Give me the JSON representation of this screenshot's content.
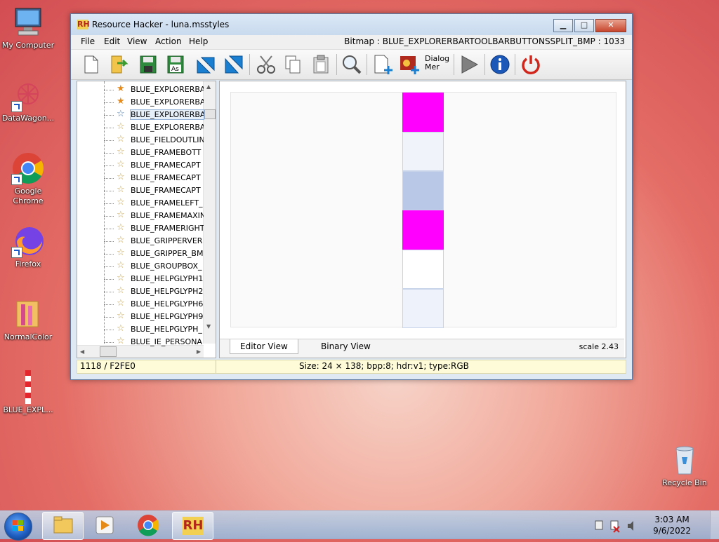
{
  "desktop": {
    "icons": [
      {
        "label": "My Computer"
      },
      {
        "label": "DataWagon..."
      },
      {
        "label": "Google Chrome"
      },
      {
        "label": "Firefox"
      },
      {
        "label": "NormalColor"
      },
      {
        "label": "BLUE_EXPL..."
      },
      {
        "label": "Recycle Bin"
      }
    ]
  },
  "window": {
    "title": "Resource Hacker - luna.msstyles",
    "app_icon_text": "RH",
    "menu": [
      "File",
      "Edit",
      "View",
      "Action",
      "Help"
    ],
    "bitmap_info": "Bitmap : BLUE_EXPLORERBARTOOLBARBUTTONSSPLIT_BMP : 1033",
    "toolbar": {
      "dialog_merge_label_1": "Dialog",
      "dialog_merge_label_2": "Mer"
    },
    "tree_items": [
      "BLUE_EXPLORERBA",
      "BLUE_EXPLORERBA",
      "BLUE_EXPLORERBA",
      "BLUE_EXPLORERBA",
      "BLUE_FIELDOUTLIN",
      "BLUE_FRAMEBOTT",
      "BLUE_FRAMECAPT",
      "BLUE_FRAMECAPT",
      "BLUE_FRAMECAPT",
      "BLUE_FRAMELEFT_",
      "BLUE_FRAMEMAXIN",
      "BLUE_FRAMERIGHT",
      "BLUE_GRIPPERVER",
      "BLUE_GRIPPER_BM",
      "BLUE_GROUPBOX_",
      "BLUE_HELPGLYPH1",
      "BLUE_HELPGLYPH2",
      "BLUE_HELPGLYPH6",
      "BLUE_HELPGLYPH9",
      "BLUE_HELPGLYPH_",
      "BLUE_IE_PERSONA"
    ],
    "selected_index": 2,
    "tabs": [
      "Editor View",
      "Binary View"
    ],
    "scale": "scale 2.43",
    "status_left": "1118 / F2FE0",
    "status_right": "Size: 24 × 138;  bpp:8;  hdr:v1;  type:RGB",
    "bitmap_cells": [
      "#ff00ff",
      "#f0f4fa",
      "#b9c8e6",
      "#ff00ff",
      "#ffffff",
      "#eef2fa"
    ]
  },
  "taskbar": {
    "time": "3:03 AM",
    "date": "9/6/2022"
  },
  "colors": {
    "magenta": "#ff00ff",
    "selection": "#94b2d8"
  }
}
